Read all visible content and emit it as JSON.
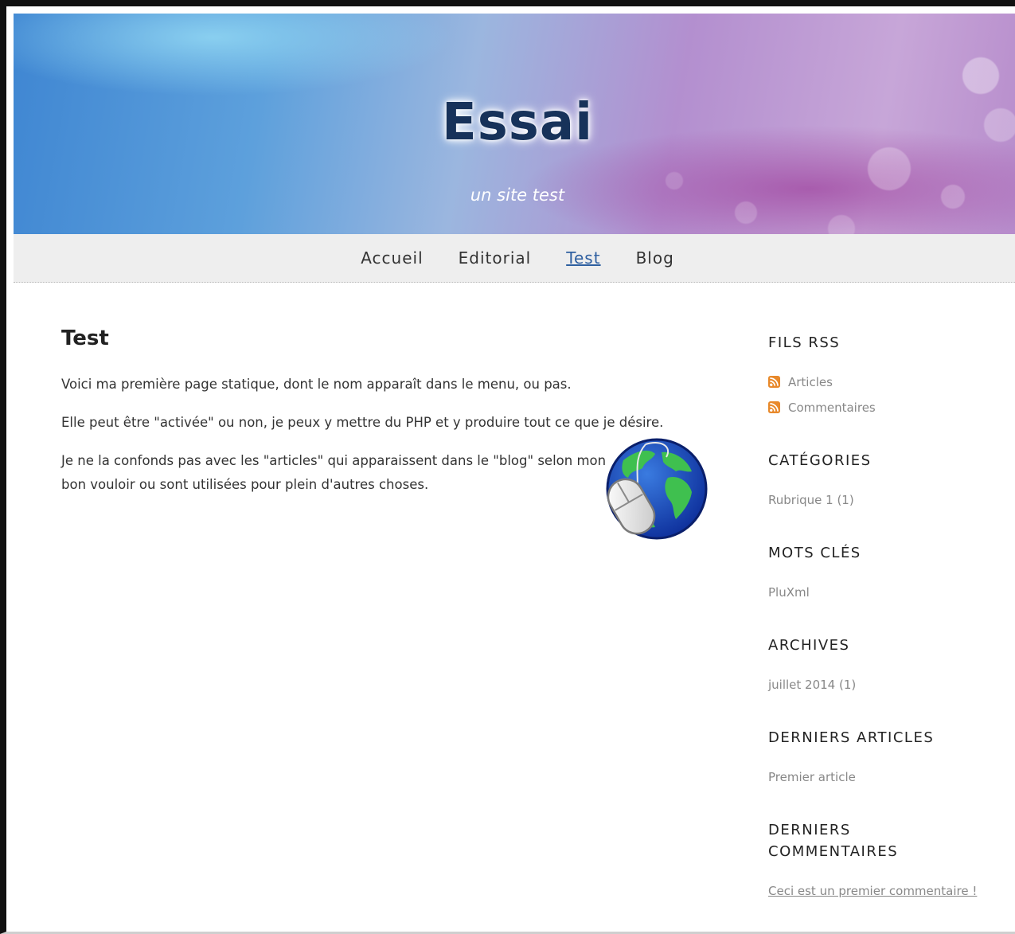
{
  "site": {
    "title": "Essai",
    "subtitle": "un site test"
  },
  "nav": {
    "items": [
      {
        "label": "Accueil"
      },
      {
        "label": "Editorial"
      },
      {
        "label": "Test",
        "active": true
      },
      {
        "label": "Blog"
      }
    ]
  },
  "page": {
    "heading": "Test",
    "paragraphs": [
      "Voici ma première page statique, dont le nom apparaît dans le menu, ou pas.",
      "Elle peut être \"activée\" ou non, je peux y mettre du PHP et y produire tout ce que je désire.",
      "Je ne la confonds pas avec les \"articles\" qui apparaissent dans le \"blog\" selon mon bon vouloir ou sont utilisées pour plein d'autres choses."
    ],
    "image_icon": "globe-mouse-icon"
  },
  "sidebar": {
    "rss": {
      "heading": "FILS RSS",
      "items": [
        "Articles",
        "Commentaires"
      ],
      "icon": "rss-icon",
      "icon_color": "#e8892b"
    },
    "categories": {
      "heading": "CATÉGORIES",
      "items": [
        "Rubrique 1 (1)"
      ]
    },
    "tags": {
      "heading": "MOTS CLÉS",
      "items": [
        "PluXml"
      ]
    },
    "archives": {
      "heading": "ARCHIVES",
      "items": [
        "juillet 2014 (1)"
      ]
    },
    "last_articles": {
      "heading": "DERNIERS ARTICLES",
      "items": [
        "Premier article"
      ]
    },
    "last_comments": {
      "heading_line1": "DERNIERS",
      "heading_line2": "COMMENTAIRES",
      "items": [
        "Ceci est un premier commentaire !"
      ]
    }
  },
  "colors": {
    "title": "#17325a",
    "nav_active": "#2e5fa0",
    "nav_bg": "#eeeeee",
    "sidebar_text": "#888888"
  }
}
